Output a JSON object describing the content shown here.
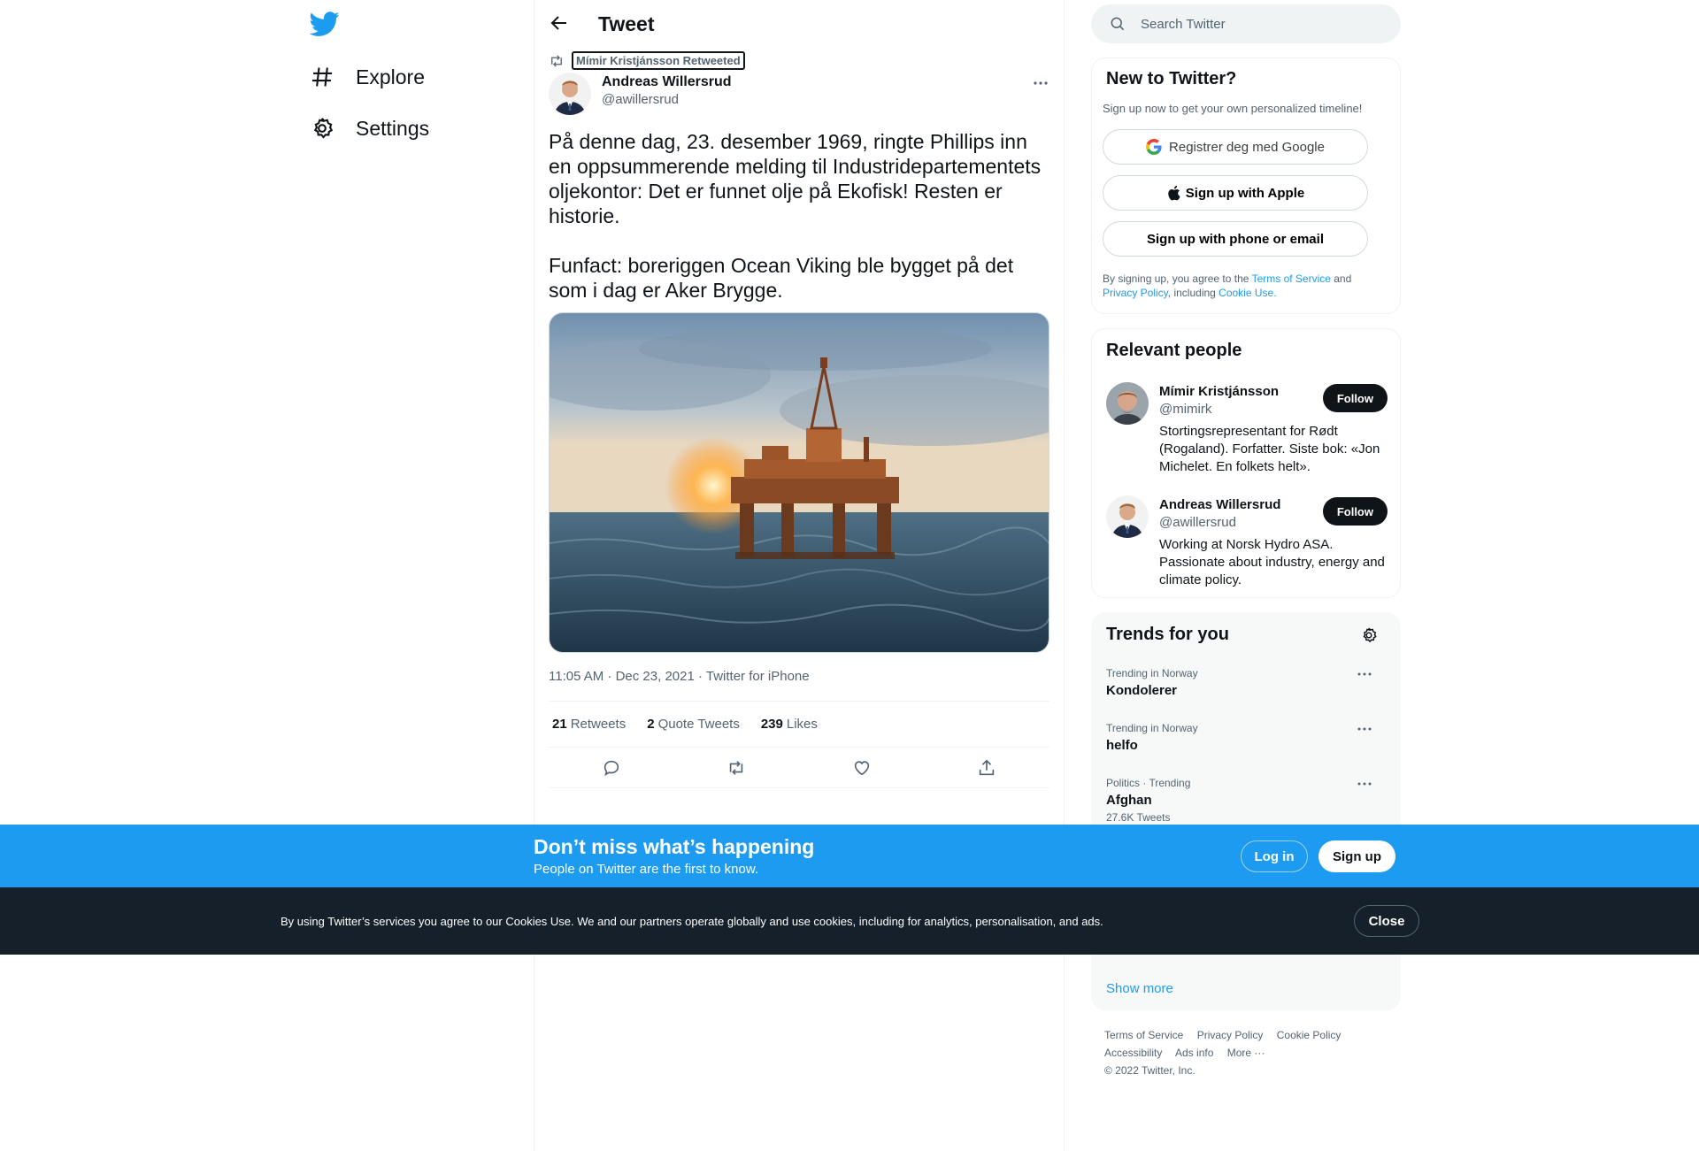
{
  "nav": {
    "explore_label": "Explore",
    "settings_label": "Settings"
  },
  "header": {
    "title": "Tweet"
  },
  "tweet": {
    "retweeted_by": "Mímir Kristjánsson Retweeted",
    "author_name": "Andreas Willersrud",
    "author_handle": "@awillersrud",
    "text": "På denne dag, 23. desember 1969, ringte Phillips inn en oppsummerende melding til Industridepartementets oljekontor: Det er funnet olje på Ekofisk! Resten er historie.\n\nFunfact: boreriggen Ocean Viking ble bygget på det som i dag er Aker Brygge.",
    "timestamp": "11:05 AM · Dec 23, 2021 · Twitter for iPhone",
    "retweets_count": "21",
    "retweets_label": "Retweets",
    "quote_count": "2",
    "quote_label": "Quote Tweets",
    "likes_count": "239",
    "likes_label": "Likes"
  },
  "search": {
    "placeholder": "Search Twitter"
  },
  "new_to_twitter": {
    "title": "New to Twitter?",
    "subtitle": "Sign up now to get your own personalized timeline!",
    "google_label": "Registrer deg med Google",
    "apple_label": "Sign up with Apple",
    "phone_label": "Sign up with phone or email",
    "legal_prefix": "By signing up, you agree to the ",
    "terms": "Terms of Service",
    "and": " and ",
    "privacy": "Privacy Policy",
    "including": ", including ",
    "cookie": "Cookie Use."
  },
  "relevant_people": {
    "title": "Relevant people",
    "people": [
      {
        "name": "Mímir Kristjánsson",
        "handle": "@mimirk",
        "bio": "Stortingsrepresentant for Rødt (Rogaland). Forfatter. Siste bok: «Jon Michelet. En folkets helt».",
        "follow": "Follow"
      },
      {
        "name": "Andreas Willersrud",
        "handle": "@awillersrud",
        "bio": "Working at Norsk Hydro ASA. Passionate about industry, energy and climate policy.",
        "follow": "Follow"
      }
    ]
  },
  "trends": {
    "title": "Trends for you",
    "items": [
      {
        "meta": "Trending in Norway",
        "name": "Kondolerer",
        "count": ""
      },
      {
        "meta": "Trending in Norway",
        "name": "helfo",
        "count": ""
      },
      {
        "meta": "Politics · Trending",
        "name": "Afghan",
        "count": "27.6K Tweets"
      }
    ],
    "show_more": "Show more"
  },
  "footer": {
    "terms": "Terms of Service",
    "privacy": "Privacy Policy",
    "cookie": "Cookie Policy",
    "accessibility": "Accessibility",
    "ads": "Ads info",
    "more": "More ···",
    "copyright": "© 2022 Twitter, Inc."
  },
  "signup_bar": {
    "title": "Don’t miss what’s happening",
    "subtitle": "People on Twitter are the first to know.",
    "login": "Log in",
    "signup": "Sign up"
  },
  "cookie_bar": {
    "text": "By using Twitter’s services you agree to our Cookies Use. We and our partners operate globally and use cookies, including for analytics, personalisation, and ads.",
    "close": "Close"
  },
  "colors": {
    "accent": "#1d9bf0",
    "text": "#0f1419",
    "muted": "#536471",
    "cookie_bg": "#15202b"
  }
}
